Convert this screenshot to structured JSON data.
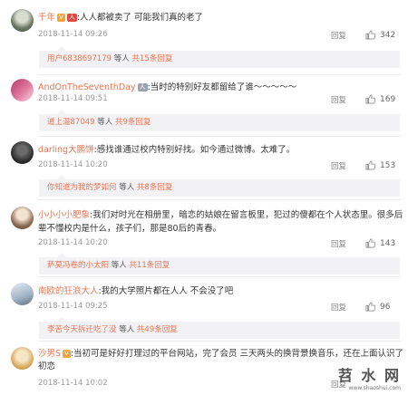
{
  "reply_label": "回复",
  "comments": [
    {
      "user": "千年",
      "badges": [
        "V",
        "人"
      ],
      "text": ":人人都被卖了 可能我们真的老了",
      "time": "2018-11-14 09:26",
      "likes": "342",
      "sub": {
        "nick": "用户6838697179",
        "mid": " 等人 ",
        "count": "共15条回复"
      }
    },
    {
      "user": "AndOnTheSeventhDay",
      "badges": [
        "人"
      ],
      "text": ":当时的特别好友都留给了谁～～～～～",
      "time": "2018-11-14 09:51",
      "likes": "169",
      "sub": {
        "nick": "道上混87049",
        "mid": " 等人 ",
        "count": "共9条回复"
      }
    },
    {
      "user": "darling大鹏饼",
      "badges": [],
      "text": ":感找谁通过校内特别好找。如今通过微博。太难了。",
      "time": "2018-11-14 10:20",
      "likes": "153",
      "sub": {
        "nick": "你知道为我的梦如何",
        "mid": " 等人 ",
        "count": "共8条回复"
      }
    },
    {
      "user": "小小小小肥象",
      "badges": [],
      "text": ":我们对时光在相册里，暗恋的姑娘在留言板里，犯过的傻都在个人状态里。很多后",
      "text2": "辈不懂校内是什么，孩子们，那是80后的青春。",
      "time": "2018-11-14 10:20",
      "likes": "143",
      "sub": {
        "nick": "萨莫冯卷的小太阳",
        "mid": " 等人 ",
        "count": "共11条回复"
      }
    },
    {
      "user": "南欧的狂浪大人",
      "badges": [],
      "text": ":我的大学照片都在人人 不会没了吧",
      "time": "2018-11-14 09:25",
      "likes": "96",
      "sub": {
        "nick": "李苦今天拆迁吃了没",
        "mid": " 等人 ",
        "count": "共49条回复"
      }
    },
    {
      "user": "沙男S",
      "badges": [
        "V"
      ],
      "text": ":当初可是好好打理过的平台网站，完了会员 三天两头的换背景换音乐，还在上面认识了",
      "text2": "初恋",
      "time": "2018-11-14 10:02",
      "likes": ""
    }
  ],
  "watermark": {
    "main": "苕 水 网",
    "sub": "www.shaoshui.com"
  }
}
